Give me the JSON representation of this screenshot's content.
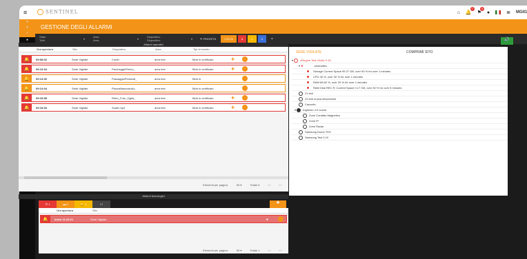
{
  "app": {
    "brand": "SENTINEL",
    "header_title": "GESTIONE DEGLI ALLARMI",
    "user_logo": "MGIG"
  },
  "topbar": {
    "badges": {
      "bell": "7",
      "alerts": "3"
    }
  },
  "filters": {
    "f1": {
      "label": "Stato",
      "value": "Tutti"
    },
    "f2": {
      "label": "Area",
      "value": "Area"
    },
    "f3": {
      "label": "Dispositivo",
      "value": "Dispositivo"
    },
    "priority_label": "PRIORITÀ",
    "counts": {
      "orange": "1 DI 21",
      "red": "6",
      "yellow": "1",
      "blue": "4"
    }
  },
  "alarms_panel": {
    "title": "Allarmi operativi",
    "columns": [
      "Ora apertura",
      "Sito",
      "Dispositivo",
      "Area",
      "Tipi di evento"
    ],
    "rows": [
      {
        "time": "09:08:02",
        "site": "Sede Vigilate",
        "device": "Cortei",
        "area": "area test",
        "event": "Blob in certificato",
        "color": "red"
      },
      {
        "time": "09:13:04",
        "site": "Sede Vigilate",
        "device": "ParcheggioPerico_",
        "area": "area test",
        "event": "Blob in certificato",
        "color": "red"
      },
      {
        "time": "09:14:00",
        "site": "Sede Vigilate",
        "device": "PassaggioPedonali_",
        "area": "area test",
        "event": "Blob in",
        "color": "orange"
      },
      {
        "time": "09:14:04",
        "site": "Sede Vigilate",
        "device": "PiazzaNascostoAz_",
        "area": "area test",
        "event": "Blob in certificato",
        "color": "orange"
      },
      {
        "time": "09:15:59",
        "site": "Sede Vigilate",
        "device": "Retro_Foto_Vigila_",
        "area": "area test",
        "event": "Blob in certificato",
        "color": "red"
      },
      {
        "time": "09:19:03",
        "site": "Sede Vigilate",
        "device": "Scatri mp4",
        "area": "area test",
        "event": "Blob in certificato",
        "color": "red"
      }
    ],
    "pager": {
      "per_page_label": "Elementi per pagina:",
      "per_page": "50",
      "total": "Totale 6"
    }
  },
  "tech_panel": {
    "title": "Allarmi tecnologici",
    "tabs": [
      "1",
      "0",
      "1",
      "7"
    ],
    "columns": [
      "Ora apertura",
      "Sito"
    ],
    "rows": [
      {
        "time": "Inizio 11:23:21",
        "site": "Sede Vigilate"
      }
    ],
    "pager": {
      "per_page_label": "Elementi per pagina:",
      "per_page": "50",
      "total": "Totale 1"
    }
  },
  "right_panel": {
    "tab_a": "SEDE VIGILATE",
    "tab_b": "COMPRIMI SITO",
    "tree": [
      {
        "level": 0,
        "label": "eRegine Test vSuite 0.18",
        "type": "red-circle"
      },
      {
        "level": 1,
        "label": "anomalies",
        "type": "red-x"
      },
      {
        "level": 2,
        "label": "Storage Current Space 99.27 GB, over 90 % for over 1 minutes",
        "type": "dot"
      },
      {
        "level": 2,
        "label": "CPU 45 %, over 30 % for over 1 minutes",
        "type": "dot"
      },
      {
        "level": 2,
        "label": "RAM 65.82 %, over 20 % for over 1 minutes",
        "type": "dot"
      },
      {
        "level": 2,
        "label": "RAM Disk REC R: Current Space 0.17 GB, over 30 % for over 5 minutes",
        "type": "dot"
      },
      {
        "level": 1,
        "label": "21 test",
        "type": "node"
      },
      {
        "level": 1,
        "label": "22 test nuova descrizione",
        "type": "node"
      },
      {
        "level": 1,
        "label": "Cancello",
        "type": "node"
      },
      {
        "level": 1,
        "label": "Ingresso 4.0 nuova",
        "type": "node-dark"
      },
      {
        "level": 2,
        "label": "Zone Contatto Magnetico",
        "type": "node"
      },
      {
        "level": 2,
        "label": "Zone IP",
        "type": "node"
      },
      {
        "level": 2,
        "label": "Zone Radar",
        "type": "node"
      },
      {
        "level": 1,
        "label": "Samsung Dome TDS",
        "type": "node"
      },
      {
        "level": 1,
        "label": "Samsung Test 0.10",
        "type": "node"
      }
    ]
  },
  "colors": {
    "accent": "#f39418",
    "danger": "#e53935",
    "info": "#3a6fd8",
    "success": "#2e9b3a"
  }
}
